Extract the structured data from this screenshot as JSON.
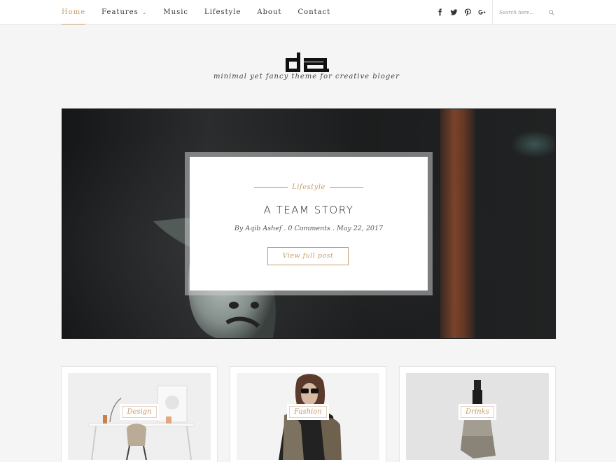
{
  "nav": {
    "items": [
      {
        "label": "Home",
        "active": true
      },
      {
        "label": "Features",
        "has_dropdown": true
      },
      {
        "label": "Music"
      },
      {
        "label": "Lifestyle"
      },
      {
        "label": "About"
      },
      {
        "label": "Contact"
      }
    ],
    "social_icons": [
      "facebook-icon",
      "twitter-icon",
      "pinterest-icon",
      "google-plus-icon"
    ],
    "search_placeholder": "Search here..."
  },
  "brand": {
    "logo_text": "da",
    "tagline": "minimal yet fancy theme for creative bloger"
  },
  "hero": {
    "category": "Lifestyle",
    "title": "A TEAM STORY",
    "meta": "By Aqib Ashef . 0 Comments . May 22, 2017",
    "button_label": "View full post"
  },
  "cards": [
    {
      "label": "Design"
    },
    {
      "label": "Fashion"
    },
    {
      "label": "Drinks"
    }
  ],
  "colors": {
    "accent": "#c69c6d",
    "background": "#f5f5f5",
    "text": "#333333"
  }
}
